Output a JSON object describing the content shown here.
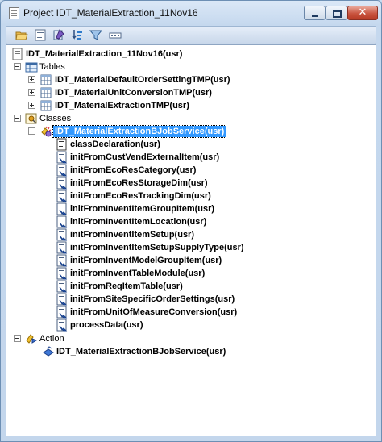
{
  "window": {
    "title": "Project IDT_MaterialExtraction_11Nov16",
    "buttons": {
      "minimize": "minimize",
      "maximize": "maximize",
      "close": "✕"
    }
  },
  "toolbar": {
    "buttons": [
      "open-folder-icon",
      "properties-icon",
      "compile-icon",
      "sort-icon",
      "filter-icon",
      "layout-icon"
    ]
  },
  "tree": {
    "root": {
      "label": "IDT_MaterialExtraction_11Nov16(usr)"
    },
    "tables": {
      "label": "Tables",
      "items": [
        "IDT_MaterialDefaultOrderSettingTMP(usr)",
        "IDT_MaterialUnitConversionTMP(usr)",
        "IDT_MaterialExtractionTMP(usr)"
      ]
    },
    "classes": {
      "label": "Classes",
      "service": {
        "label": "IDT_MaterialExtractionBJobService(usr)",
        "methods": [
          "classDeclaration(usr)",
          "initFromCustVendExternalItem(usr)",
          "initFromEcoResCategory(usr)",
          "initFromEcoResStorageDim(usr)",
          "initFromEcoResTrackingDim(usr)",
          "initFromInventItemGroupItem(usr)",
          "initFromInventItemLocation(usr)",
          "initFromInventItemSetup(usr)",
          "initFromInventItemSetupSupplyType(usr)",
          "initFromInventModelGroupItem(usr)",
          "initFromInventTableModule(usr)",
          "initFromReqItemTable(usr)",
          "initFromSiteSpecificOrderSettings(usr)",
          "initFromUnitOfMeasureConversion(usr)",
          "processData(usr)"
        ]
      }
    },
    "action": {
      "label": "Action",
      "items": [
        "IDT_MaterialExtractionBJobService(usr)"
      ]
    }
  }
}
